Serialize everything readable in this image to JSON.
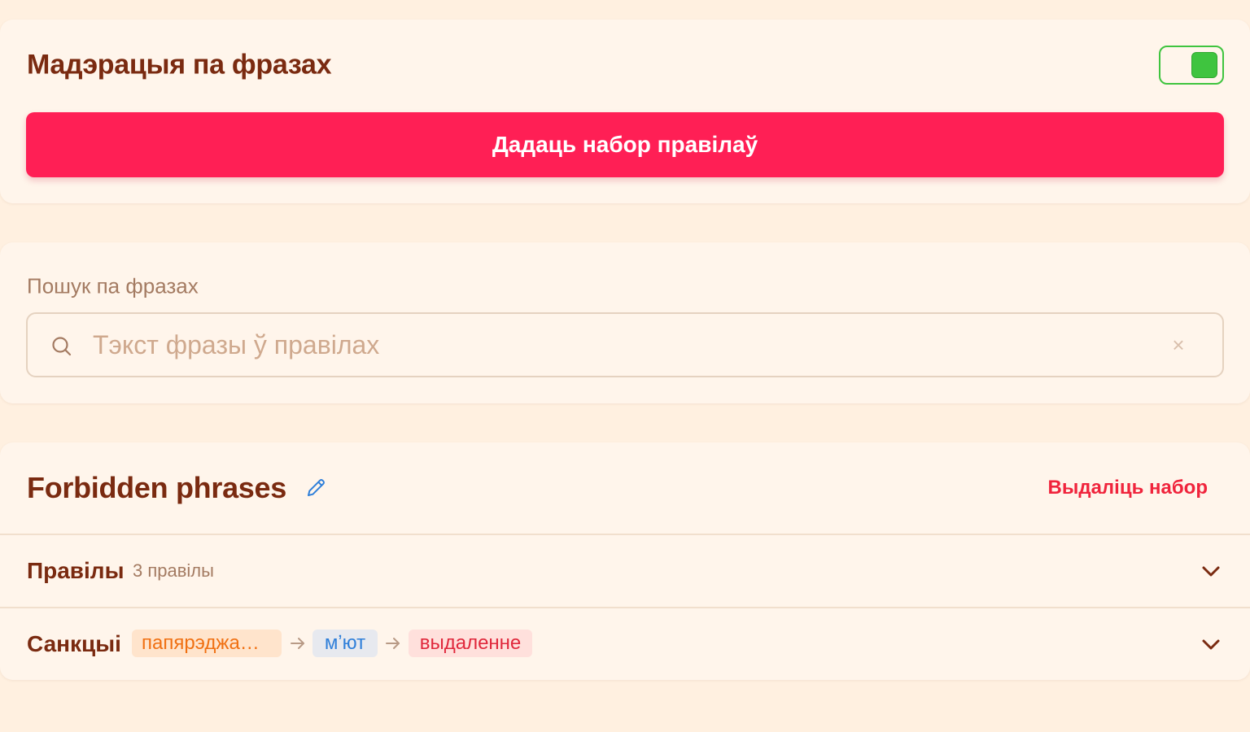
{
  "moderation": {
    "title": "Мадэрацыя па фразах",
    "enabled": true,
    "add_button_label": "Дадаць набор правілаў"
  },
  "search": {
    "label": "Пошук па фразах",
    "placeholder": "Тэкст фразы ў правілах",
    "value": "",
    "clear_symbol": "×"
  },
  "ruleset": {
    "name": "Forbidden phrases",
    "delete_label": "Выдаліць набор",
    "rules": {
      "label": "Правілы",
      "count_text": "3 правілы"
    },
    "sanctions": {
      "label": "Санкцыі",
      "steps": [
        "папярэджа…",
        "мʼют",
        "выдаленне"
      ]
    }
  },
  "colors": {
    "accent": "#ff1f55",
    "toggle_on": "#3fc43f",
    "title": "#7a2a10",
    "danger": "#f0243c",
    "page_bg": "#fff0e0",
    "card_bg": "#fff5eb"
  }
}
